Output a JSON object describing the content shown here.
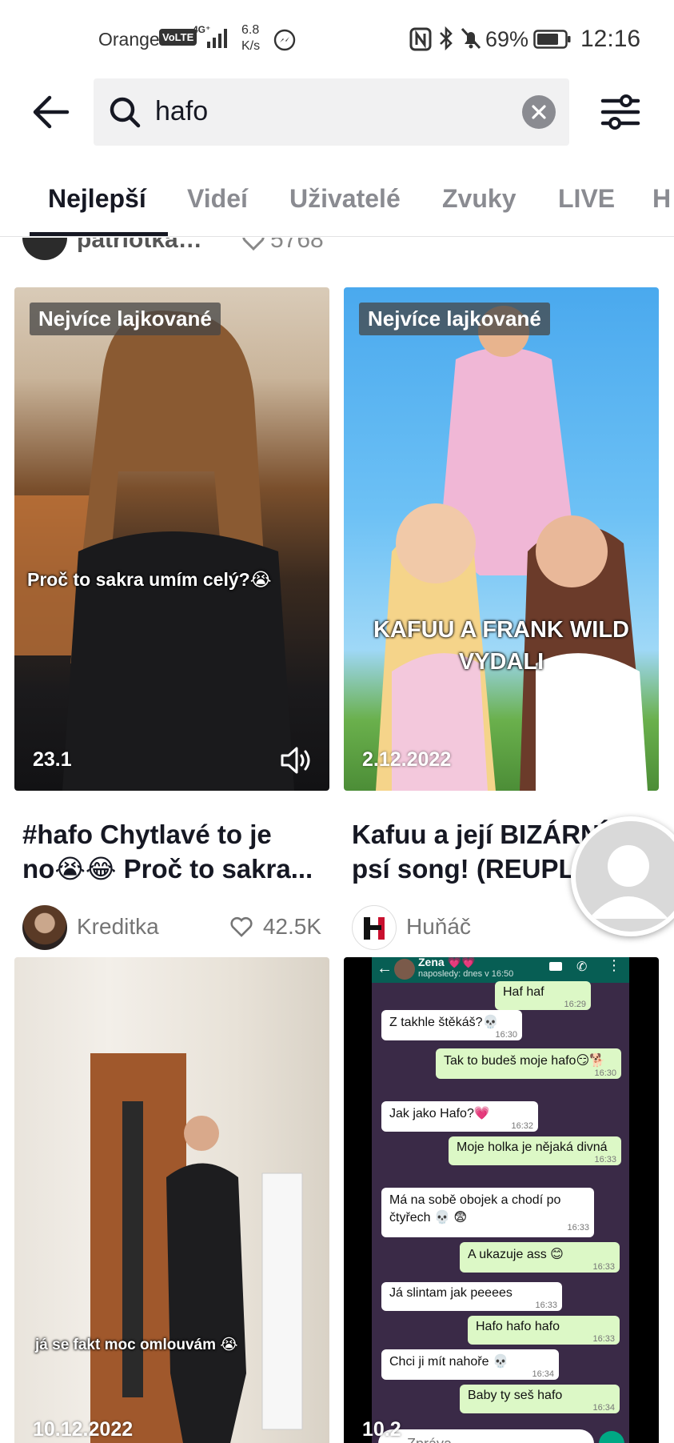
{
  "status_bar": {
    "carrier": "Orange",
    "volte": "VoLTE",
    "network": "4G⁺",
    "speed": "6.8 K/s",
    "battery_percent": "69%",
    "time": "12:16"
  },
  "search": {
    "query": "hafo"
  },
  "tabs": [
    {
      "label": "Nejlepší",
      "active": true
    },
    {
      "label": "Videí",
      "active": false
    },
    {
      "label": "Uživatelé",
      "active": false
    },
    {
      "label": "Zvuky",
      "active": false
    },
    {
      "label": "LIVE",
      "active": false
    },
    {
      "label": "H",
      "active": false
    }
  ],
  "partial_row": {
    "name": "patriotka…",
    "likes": "5768"
  },
  "cards": [
    {
      "badge": "Nejvíce lajkované",
      "overlay": "Proč to sakra umím celý?😭",
      "date": "23.1",
      "caption_line1": "#hafo Chytlavé to je",
      "caption_line2": "no😭😂 Proč to sakra...",
      "author": "Kreditka",
      "likes": "42.5K"
    },
    {
      "badge": "Nejvíce lajkované",
      "overlay_line1": "KAFUU A FRANK WILD",
      "overlay_line2": "VYDALI",
      "date": "2.12.2022",
      "caption_line1": "Kafuu a její BIZÁRNÍ",
      "caption_line2": "psí song!  (REUPLO",
      "author": "Huňáč"
    },
    {
      "overlay": "já se fakt moc omlouvám 😭",
      "date": "10.12.2022"
    },
    {
      "date": "10.2",
      "chat": {
        "contact": "Zena 💗💗",
        "last_seen": "naposledy: dnes v 16:50",
        "messages": [
          {
            "text": "Haf haf",
            "time": "16:29",
            "out": true
          },
          {
            "text": "Z takhle štěkáš?💀",
            "time": "16:30",
            "out": false
          },
          {
            "text": "Tak to budeš moje hafo😏🐕",
            "time": "16:30",
            "out": true
          },
          {
            "text": "Jak jako Hafo?💗",
            "time": "16:32",
            "out": false
          },
          {
            "text": "Moje holka je nějaká divná",
            "time": "16:33",
            "out": true
          },
          {
            "text": "Má na sobě obojek a chodí po čtyřech 💀 😨",
            "time": "16:33",
            "out": false
          },
          {
            "text": "A ukazuje ass 😊",
            "time": "16:33",
            "out": true
          },
          {
            "text": "Já slintam jak peeees",
            "time": "16:33",
            "out": false
          },
          {
            "text": "Hafo hafo hafo",
            "time": "16:33",
            "out": true
          },
          {
            "text": "Chci ji mít nahoře 💀",
            "time": "16:34",
            "out": false
          },
          {
            "text": "Baby ty seš hafo",
            "time": "16:34",
            "out": true
          }
        ],
        "input_placeholder": "Zpráva"
      }
    }
  ]
}
